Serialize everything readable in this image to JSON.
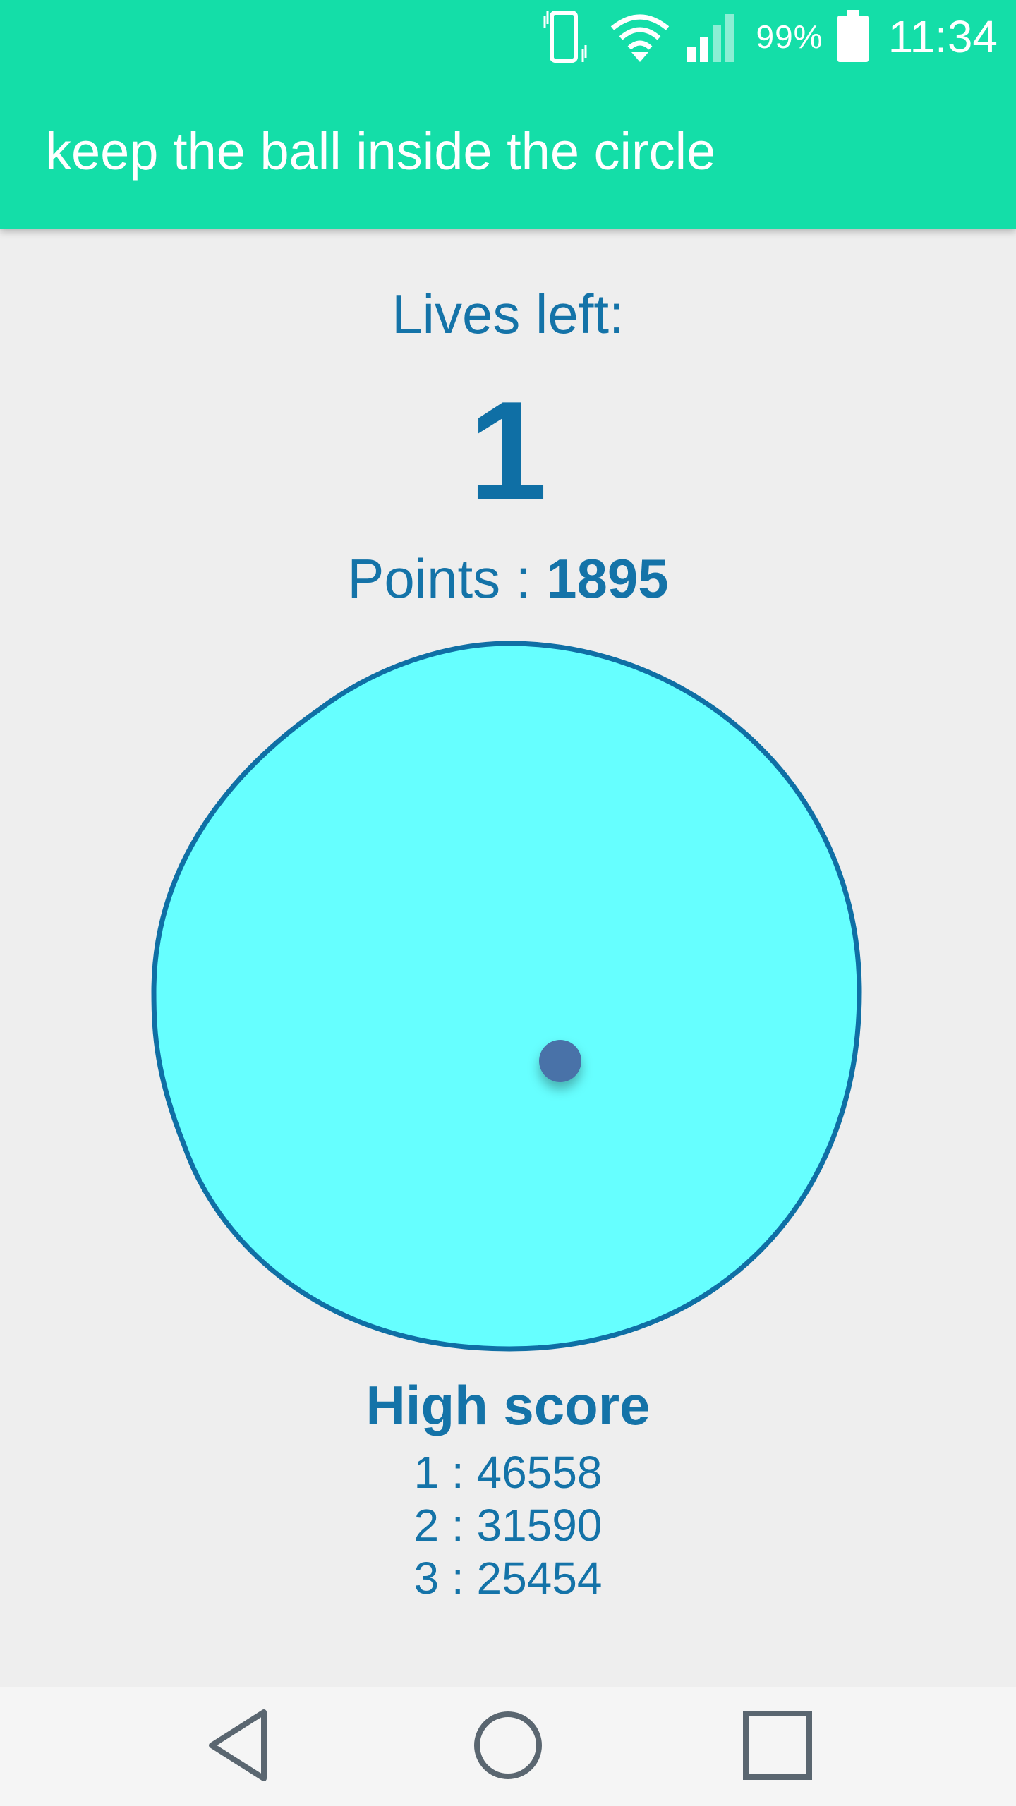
{
  "status_bar": {
    "battery_percent": "99%",
    "time": "11:34",
    "icons": [
      "vibrate-icon",
      "wifi-icon",
      "cell-signal-icon",
      "battery-icon"
    ]
  },
  "app_bar": {
    "title": "keep the ball inside the circle"
  },
  "game": {
    "lives_label": "Lives left:",
    "lives_value": "1",
    "points_label": "Points : ",
    "points_value": "1895",
    "circle_fill": "#66ffff",
    "circle_stroke": "#0f6fa5",
    "ball_color": "#4a72a8"
  },
  "high_score": {
    "title": "High score",
    "entries": [
      "1 : 46558",
      "2 : 31590",
      "3 : 25454"
    ]
  },
  "nav_bar": {
    "icons": [
      "back-icon",
      "home-icon",
      "recents-icon"
    ]
  },
  "colors": {
    "accent": "#14dea8",
    "text": "#1473a8",
    "background": "#eeeeee"
  }
}
